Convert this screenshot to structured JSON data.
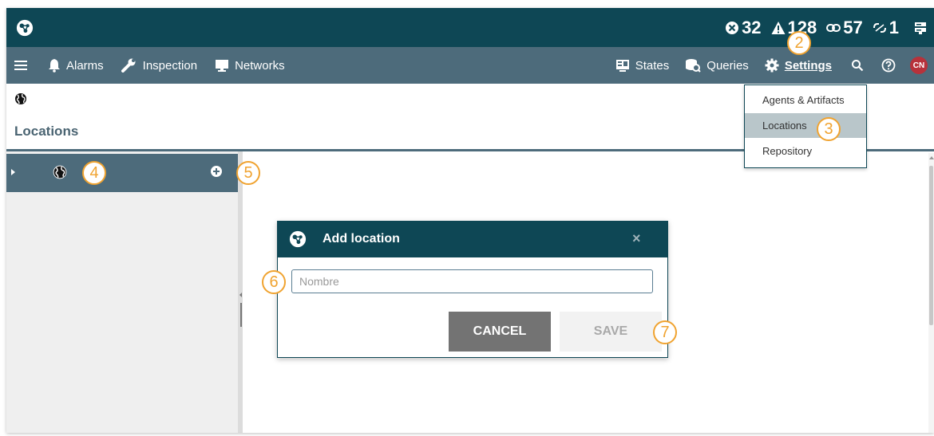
{
  "topbar": {
    "counters": [
      {
        "icon": "error-circle-icon",
        "value": "32"
      },
      {
        "icon": "warning-triangle-icon",
        "value": "128"
      },
      {
        "icon": "link-icon",
        "value": "57"
      },
      {
        "icon": "broken-link-icon",
        "value": "1"
      }
    ],
    "server_icon": "server-icon"
  },
  "nav": {
    "left": [
      {
        "label": "Alarms",
        "icon": "bell-icon"
      },
      {
        "label": "Inspection",
        "icon": "wrench-icon"
      },
      {
        "label": "Networks",
        "icon": "monitor-icon"
      }
    ],
    "right": [
      {
        "label": "States",
        "icon": "states-icon"
      },
      {
        "label": "Queries",
        "icon": "queries-icon"
      },
      {
        "label": "Settings",
        "icon": "gear-icon"
      }
    ],
    "avatar": "CN"
  },
  "page": {
    "title": "Locations"
  },
  "settings_menu": {
    "items": [
      "Agents & Artifacts",
      "Locations",
      "Repository"
    ],
    "selected": "Locations"
  },
  "dialog": {
    "title": "Add location",
    "close": "×",
    "input_placeholder": "Nombre",
    "input_value": "",
    "cancel_label": "CANCEL",
    "save_label": "SAVE"
  },
  "callouts": [
    "2",
    "3",
    "4",
    "5",
    "6",
    "7"
  ],
  "colors": {
    "topbar": "#0e4755",
    "navbar": "#4d6b7b",
    "accent_callout": "#f0a330",
    "avatar": "#b7323b"
  }
}
